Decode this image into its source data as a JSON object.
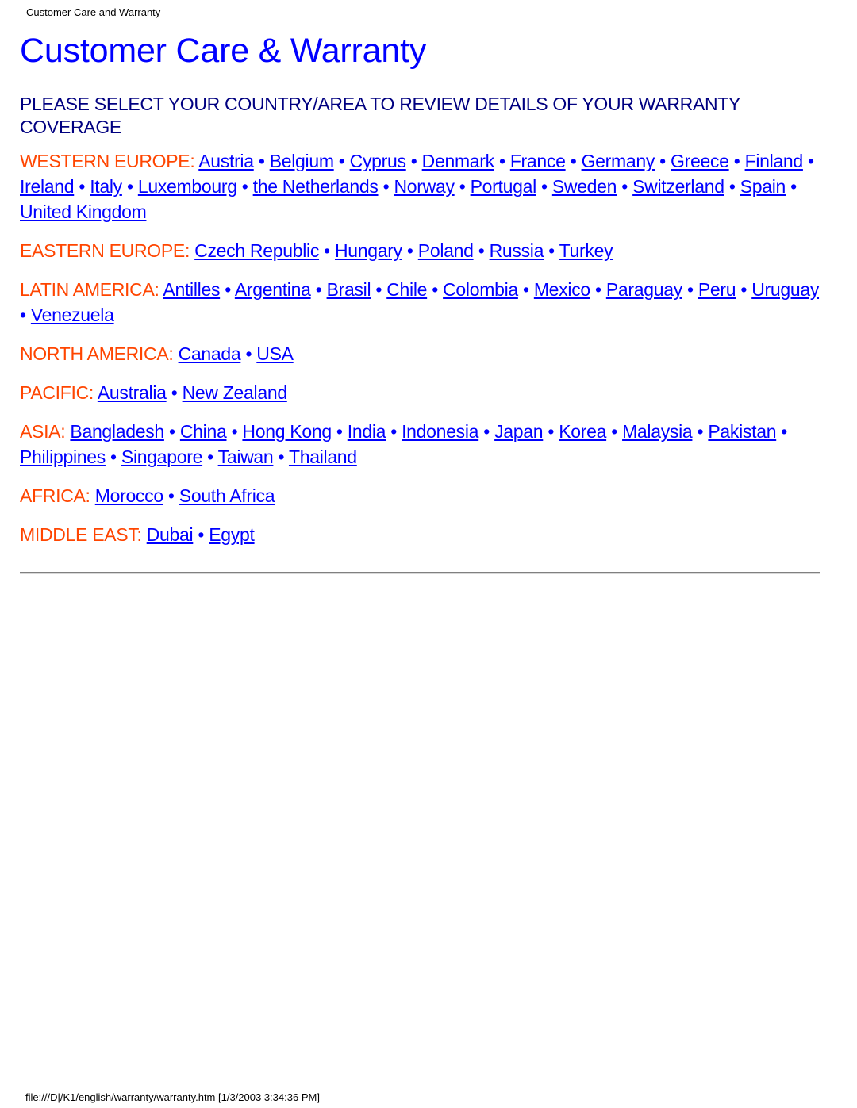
{
  "header": {
    "title": "Customer Care and Warranty"
  },
  "page": {
    "title": "Customer Care & Warranty",
    "subheading": "PLEASE SELECT YOUR COUNTRY/AREA TO REVIEW DETAILS OF YOUR WARRANTY COVERAGE"
  },
  "colors": {
    "title": "#0000ff",
    "subheading": "#000080",
    "region_label": "#ff4500",
    "link": "#0000ff"
  },
  "separator": "•",
  "regions": [
    {
      "label": "WESTERN EUROPE:",
      "countries": [
        "Austria",
        "Belgium",
        "Cyprus",
        "Denmark",
        "France",
        "Germany",
        "Greece",
        "Finland",
        "Ireland",
        "Italy",
        "Luxembourg",
        "the Netherlands",
        "Norway",
        "Portugal",
        "Sweden",
        "Switzerland",
        "Spain",
        "United Kingdom"
      ]
    },
    {
      "label": "EASTERN EUROPE:",
      "countries": [
        "Czech Republic",
        "Hungary",
        "Poland",
        "Russia",
        "Turkey"
      ]
    },
    {
      "label": "LATIN AMERICA:",
      "countries": [
        "Antilles",
        "Argentina",
        "Brasil",
        "Chile",
        "Colombia",
        "Mexico",
        "Paraguay",
        "Peru",
        "Uruguay",
        "Venezuela"
      ]
    },
    {
      "label": "NORTH AMERICA:",
      "countries": [
        "Canada",
        "USA"
      ]
    },
    {
      "label": "PACIFIC:",
      "countries": [
        "Australia",
        "New Zealand"
      ]
    },
    {
      "label": "ASIA:",
      "countries": [
        "Bangladesh",
        "China",
        "Hong Kong",
        "India",
        "Indonesia",
        "Japan",
        "Korea",
        "Malaysia",
        "Pakistan",
        "Philippines",
        "Singapore",
        "Taiwan",
        "Thailand"
      ]
    },
    {
      "label": "AFRICA:",
      "countries": [
        "Morocco",
        "South Africa"
      ]
    },
    {
      "label": "MIDDLE EAST:",
      "countries": [
        "Dubai",
        "Egypt"
      ]
    }
  ],
  "footer": {
    "path": "file:///D|/K1/english/warranty/warranty.htm [1/3/2003 3:34:36 PM]"
  }
}
